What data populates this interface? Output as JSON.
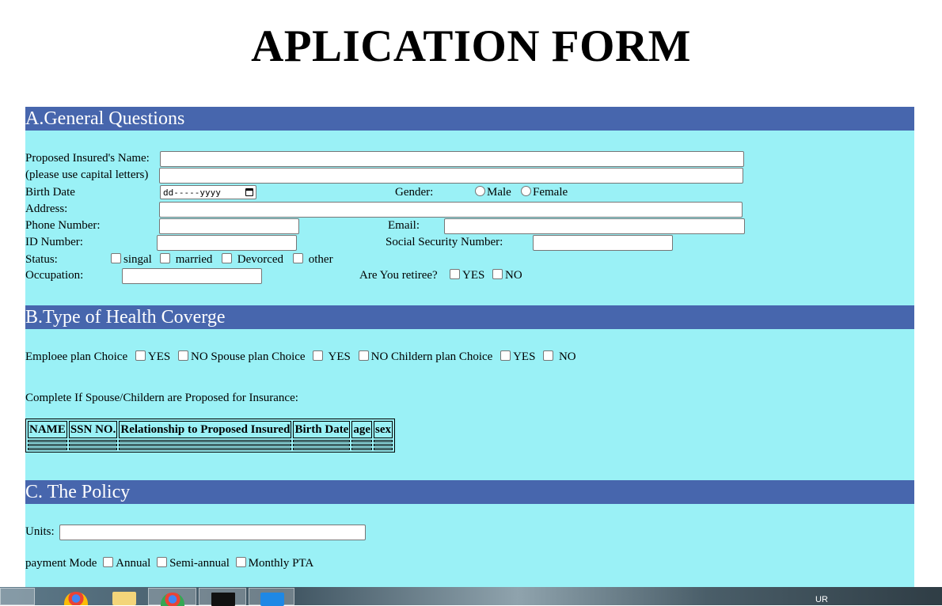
{
  "title": "APLICATION FORM",
  "section_a": {
    "heading": "A.General Questions",
    "name_label": "Proposed Insured's Name:",
    "name_hint": "(please use capital letters)",
    "birth_label": "Birth Date",
    "date_placeholder": "dd-----yyyy",
    "gender_label": "Gender:",
    "male": "Male",
    "female": "Female",
    "address_label": "Address:",
    "phone_label": "Phone Number:",
    "email_label": "Email:",
    "id_label": "ID Number:",
    "ssn_label": "Social Security Number:",
    "status_label": "Status:",
    "status_options": [
      "singal",
      "married",
      "Devorced",
      "other"
    ],
    "occupation_label": "Occupation:",
    "retiree_label": "Are You retiree?",
    "yes": "YES",
    "no": "NO"
  },
  "section_b": {
    "heading": "B.Type of Health Coverge",
    "employee_label": "Emploee plan Choice",
    "spouse_label": "Spouse plan Choice",
    "children_label": "Childern plan Choice",
    "yes": "YES",
    "no": "NO",
    "complete_text": "Complete If Spouse/Childern are Proposed for Insurance:",
    "table_headers": [
      "NAME",
      "SSN NO.",
      "Relationship to Proposed Insured",
      "Birth Date",
      "age",
      "sex"
    ]
  },
  "section_c": {
    "heading": "C. The Policy",
    "units_label": "Units:",
    "payment_label": "payment Mode",
    "payment_options": [
      "Annual",
      "Semi-annual",
      "Monthly PTA"
    ]
  },
  "taskbar": {
    "lang": "UR"
  }
}
